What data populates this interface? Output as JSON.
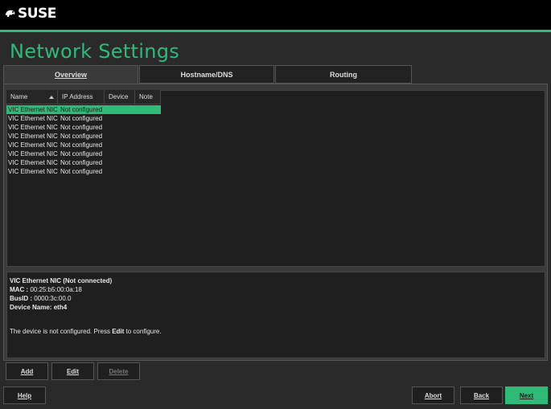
{
  "brand": {
    "logo_text": "SUSE",
    "accent": "#30ba78"
  },
  "page": {
    "title": "Network Settings"
  },
  "tabs": [
    {
      "label": "Overview",
      "active": true
    },
    {
      "label": "Hostname/DNS",
      "active": false
    },
    {
      "label": "Routing",
      "active": false
    }
  ],
  "table": {
    "columns": [
      "Name",
      "IP Address",
      "Device",
      "Note"
    ],
    "rows": [
      {
        "name": "VIC Ethernet NIC",
        "ip": "Not configured",
        "selected": true
      },
      {
        "name": "VIC Ethernet NIC",
        "ip": "Not configured",
        "selected": false
      },
      {
        "name": "VIC Ethernet NIC",
        "ip": "Not configured",
        "selected": false
      },
      {
        "name": "VIC Ethernet NIC",
        "ip": "Not configured",
        "selected": false
      },
      {
        "name": "VIC Ethernet NIC",
        "ip": "Not configured",
        "selected": false
      },
      {
        "name": "VIC Ethernet NIC",
        "ip": "Not configured",
        "selected": false
      },
      {
        "name": "VIC Ethernet NIC",
        "ip": "Not configured",
        "selected": false
      },
      {
        "name": "VIC Ethernet NIC",
        "ip": "Not configured",
        "selected": false
      }
    ]
  },
  "details": {
    "heading": "VIC Ethernet NIC (Not connected)",
    "mac_label": "MAC :",
    "mac_value": "00:25:b5:00:0a:18",
    "busid_label": "BusID :",
    "busid_value": "0000:3c:00.0",
    "device_label": "Device Name:",
    "device_value": "eth4",
    "note_pre": "The device is not configured. Press ",
    "note_bold": "Edit",
    "note_post": " to configure."
  },
  "actions": {
    "add": "Add",
    "edit": "Edit",
    "delete": "Delete"
  },
  "footer": {
    "help": "Help",
    "abort": "Abort",
    "back": "Back",
    "next": "Next"
  }
}
